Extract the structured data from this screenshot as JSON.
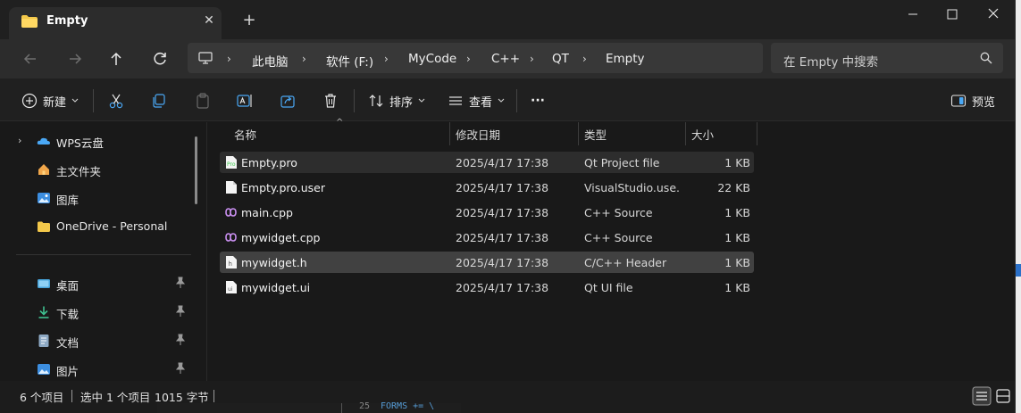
{
  "window": {
    "tab_title": "Empty",
    "new_tab_glyph": "+",
    "close_tab_glyph": "✕"
  },
  "address": {
    "crumbs": [
      "此电脑",
      "软件 (F:)",
      "MyCode",
      "C++",
      "QT",
      "Empty"
    ],
    "separator": "›"
  },
  "search": {
    "placeholder": "在 Empty 中搜索"
  },
  "commands": {
    "new_label": "新建",
    "sort_label": "排序",
    "view_label": "查看",
    "more_label": "···",
    "preview_label": "预览"
  },
  "sidebar": {
    "items": [
      {
        "label": "WPS云盘",
        "icon": "cloud-icon"
      },
      {
        "label": "主文件夹",
        "icon": "home-icon"
      },
      {
        "label": "图库",
        "icon": "gallery-icon"
      },
      {
        "label": "OneDrive - Personal",
        "icon": "folder-icon"
      },
      {
        "label": "桌面",
        "icon": "desktop-icon"
      },
      {
        "label": "下载",
        "icon": "download-icon"
      },
      {
        "label": "文档",
        "icon": "document-icon"
      },
      {
        "label": "图片",
        "icon": "picture-icon"
      }
    ]
  },
  "columns": {
    "name": "名称",
    "modified": "修改日期",
    "type": "类型",
    "size": "大小"
  },
  "files": [
    {
      "name": "Empty.pro",
      "modified": "2025/4/17 17:38",
      "type": "Qt Project file",
      "size": "1 KB",
      "icon": "qt-project-icon"
    },
    {
      "name": "Empty.pro.user",
      "modified": "2025/4/17 17:38",
      "type": "VisualStudio.use...",
      "size": "22 KB",
      "icon": "file-icon"
    },
    {
      "name": "main.cpp",
      "modified": "2025/4/17 17:38",
      "type": "C++ Source",
      "size": "1 KB",
      "icon": "cpp-source-icon"
    },
    {
      "name": "mywidget.cpp",
      "modified": "2025/4/17 17:38",
      "type": "C++ Source",
      "size": "1 KB",
      "icon": "cpp-source-icon"
    },
    {
      "name": "mywidget.h",
      "modified": "2025/4/17 17:38",
      "type": "C/C++ Header",
      "size": "1 KB",
      "icon": "header-file-icon"
    },
    {
      "name": "mywidget.ui",
      "modified": "2025/4/17 17:38",
      "type": "Qt UI file",
      "size": "1 KB",
      "icon": "ui-file-icon"
    }
  ],
  "status": {
    "count": "6 个项目",
    "selected": "选中 1 个项目",
    "selected_size": "1015 字节"
  },
  "editor_peek": {
    "line_number": "25",
    "code": "FORMS  += \\"
  },
  "colors": {
    "window_bg": "#191919",
    "titlebar_bg": "#202020",
    "address_row_bg": "#2c2c2c",
    "field_bg": "#383838",
    "selected_row": "#2d2d2d",
    "hover_row": "#414141",
    "folder_yellow": "#f3c84a",
    "accent_blue": "#3aa0f0"
  }
}
